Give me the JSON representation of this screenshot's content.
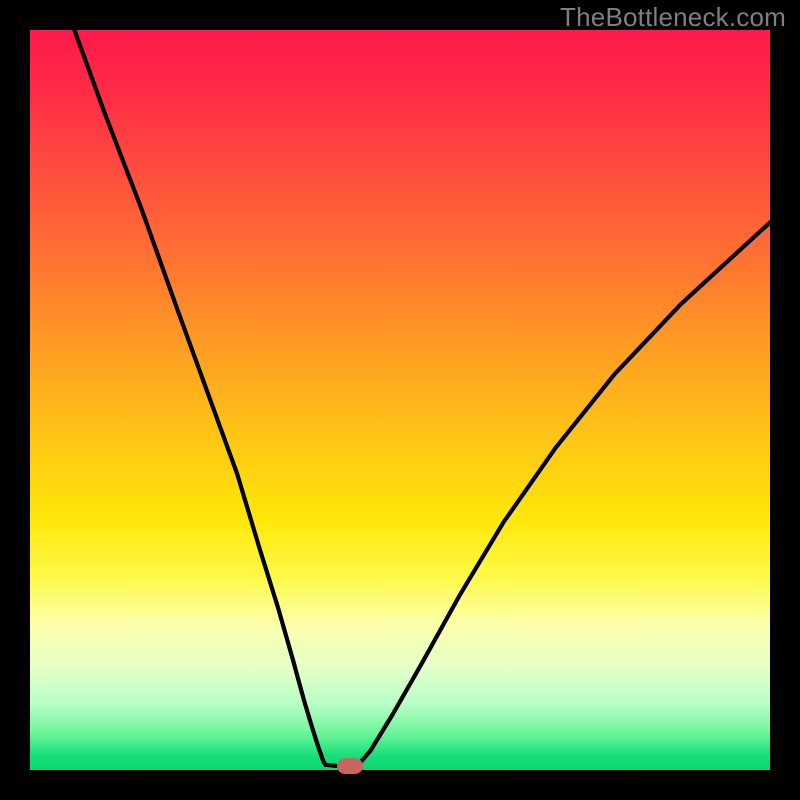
{
  "watermark": "TheBottleneck.com",
  "chart_data": {
    "type": "line",
    "title": "",
    "xlabel": "",
    "ylabel": "",
    "xlim": [
      0,
      100
    ],
    "ylim": [
      0,
      100
    ],
    "series": [
      {
        "name": "curve-left",
        "x": [
          6,
          10,
          15,
          20,
          24,
          28,
          31,
          33.5,
          35.5,
          37,
          38.2,
          39,
          39.6,
          39.9
        ],
        "y": [
          100,
          89,
          76,
          62,
          51,
          40,
          30,
          22,
          15,
          9.5,
          5.5,
          3,
          1.3,
          0.7
        ]
      },
      {
        "name": "curve-flat",
        "x": [
          39.9,
          44
        ],
        "y": [
          0.7,
          0.3
        ]
      },
      {
        "name": "curve-right",
        "x": [
          44,
          46,
          49,
          53,
          58,
          64,
          71,
          79,
          88,
          100
        ],
        "y": [
          0.3,
          2.6,
          7.5,
          14.5,
          23.5,
          33.5,
          43.5,
          53.5,
          63,
          74
        ]
      }
    ],
    "marker": {
      "x": 43.2,
      "y": 0.6,
      "color": "#c9655e"
    },
    "background_gradient": {
      "top": "#ff1a4b",
      "mid": "#ffe70a",
      "bottom": "#07d86f"
    }
  }
}
